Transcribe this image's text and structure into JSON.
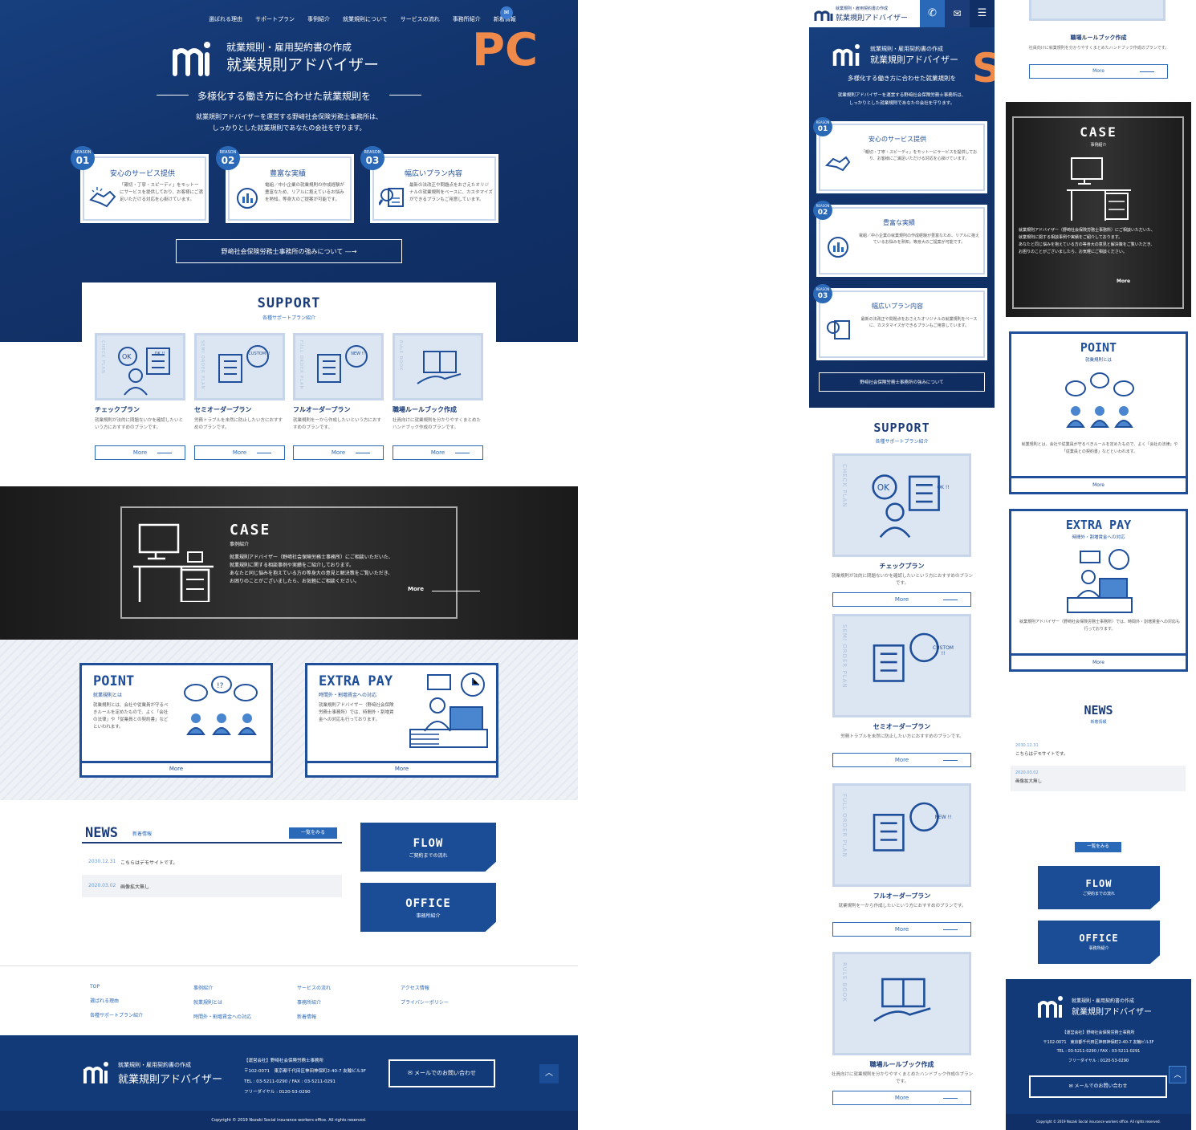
{
  "overlay_labels": {
    "pc": "PC",
    "sp": "SP"
  },
  "nav": [
    "選ばれる理由",
    "サポートプラン",
    "事例紹介",
    "就業規則について",
    "サービスの流れ",
    "事務所紹介",
    "新着情報"
  ],
  "brand": {
    "sub": "就業規則・雇用契約書の作成",
    "name": "就業規則アドバイザー"
  },
  "hero": {
    "catch": "多様化する働き方に合わせた就業規則を",
    "lead1": "就業規則アドバイザーを運営する野﨑社会保険労務士事務所は、",
    "lead2": "しっかりとした就業規則であなたの会社を守ります。",
    "button": "野﨑社会保険労務士事務所の強みについて"
  },
  "reasons": [
    {
      "badge": "REASON",
      "num": "01",
      "title": "安心のサービス提供",
      "text": "「親切・丁寧・スピーディ」をモットーにサービスを提供しており、お客様にご満足いただける対応を心掛けています。"
    },
    {
      "badge": "REASON",
      "num": "02",
      "title": "豊富な実績",
      "text": "電組／中小企業の就業規則の作成経験が豊富なため、リアルに抱えているお悩みを熟知。等身大のご提案が可能です。"
    },
    {
      "badge": "REASON",
      "num": "03",
      "title": "幅広いプラン内容",
      "text": "最新の法改正や問題点をおさえたオリジナルの就業規則をベースに、カスタマイズができるプランもご用意しています。"
    }
  ],
  "support": {
    "title": "SUPPORT",
    "sub": "各種サポートプラン紹介",
    "plans": [
      {
        "vertical": "CHECK PLAN",
        "name": "チェックプラン",
        "desc": "就業規則が法的に問題ないかを確認したいという方におすすめのプランです。",
        "more": "More",
        "bubble": "OK !!"
      },
      {
        "vertical": "SEMI ORDER PLAN",
        "name": "セミオーダープラン",
        "desc": "労務トラブルを未然に防止したい方におすすめのプランです。",
        "more": "More",
        "bubble": "CUSTOM !!"
      },
      {
        "vertical": "FULL ORDER PLAN",
        "name": "フルオーダープラン",
        "desc": "就業規則を一から作成したいという方におすすめのプランです。",
        "more": "More",
        "bubble": "NEW !!"
      },
      {
        "vertical": "RULE BOOK",
        "name": "職場ルールブック作成",
        "desc": "社員向けに就業規則を分かりやすくまとめたハンドブック作成のプランです。",
        "more": "More",
        "bubble": ""
      }
    ]
  },
  "case": {
    "title": "CASE",
    "sub": "事例紹介",
    "text1": "就業規則アドバイザー（野﨑社会保険労務士事務所）にご相談いただいた、",
    "text2": "就業規則に関する相談事例や実績をご紹介しております。",
    "text3": "あなたと同じ悩みを抱えている方の等身大の意見と解決策をご覧いただき、",
    "text4": "お困りのことがございましたら、お気軽にご相談ください。",
    "more": "More"
  },
  "point": {
    "title": "POINT",
    "sub": "就業規則とは",
    "text": "就業規則とは、会社や従業員が守るべきルールを定めたもので、よく「会社の法律」や「従業員との契約書」などといわれます。",
    "more": "More"
  },
  "extra": {
    "title": "EXTRA PAY",
    "sub": "時間外・割増賃金への対応",
    "text": "就業規則アドバイザー（野﨑社会保険労務士事務所）では、時間外・割増賃金への対応も行っております。",
    "more": "More"
  },
  "news": {
    "title": "NEWS",
    "sub": "新着情報",
    "list_btn": "一覧をみる",
    "items": [
      {
        "date": "2030.12.31",
        "text": "こちらはデモサイトです。"
      },
      {
        "date": "2020.03.02",
        "text": "画像拡大無し"
      }
    ]
  },
  "banners": [
    {
      "title": "FLOW",
      "sub": "ご契約までの流れ"
    },
    {
      "title": "OFFICE",
      "sub": "事務所紹介"
    }
  ],
  "footer_nav": [
    [
      "TOP",
      "選ばれる理由",
      "各種サポートプラン紹介"
    ],
    [
      "事例紹介",
      "就業規則とは",
      "時間外・割増賃金への対応"
    ],
    [
      "サービスの流れ",
      "事務所紹介",
      "新着情報"
    ],
    [
      "アクセス情報",
      "プライバシーポリシー"
    ]
  ],
  "footer": {
    "company": "【運営会社】野﨑社会保険労務士事務所",
    "address": "〒102-0071　東京都千代田区神田神保町2-40-7 友輪ビル3F",
    "tel": "TEL : 03-5211-0290 / FAX : 03-5211-0291",
    "free": "フリーダイヤル : 0120-53-0290",
    "mail_btn": "メールでのお問い合わせ",
    "copyright": "Copyright © 2019 Nozaki Social insurance workers office. All rights reserved."
  },
  "colors": {
    "navy": "#123a78",
    "blue": "#1f4f9a",
    "accent": "#f08a4b",
    "light": "#dce6f3"
  }
}
